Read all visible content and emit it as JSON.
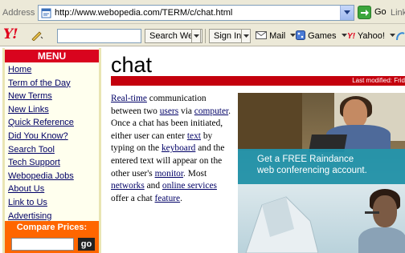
{
  "browser": {
    "address_label": "Address",
    "url": "http://www.webopedia.com/TERM/c/chat.html",
    "go_label": "Go",
    "links_label": "Links"
  },
  "yahoo_toolbar": {
    "logo": "Y!",
    "search_value": "",
    "search_web_label": "Search Web",
    "sign_in_label": "Sign In",
    "mail_label": "Mail",
    "games_label": "Games",
    "yahoo_label": "Yahoo!",
    "yahoo_icon_text": "Y!"
  },
  "menu": {
    "header": "MENU",
    "items": [
      {
        "label": "Home"
      },
      {
        "label": "Term of the Day"
      },
      {
        "label": "New Terms"
      },
      {
        "label": "New Links"
      },
      {
        "label": "Quick Reference"
      },
      {
        "label": "Did You Know?"
      },
      {
        "label": "Search Tool"
      },
      {
        "label": "Tech Support"
      },
      {
        "label": "Webopedia Jobs"
      },
      {
        "label": "About Us"
      },
      {
        "label": "Link to Us"
      },
      {
        "label": "Advertising"
      }
    ],
    "compare_label": "Compare Prices:",
    "compare_value": "",
    "compare_go": "go"
  },
  "article": {
    "title": "chat",
    "last_modified": "Last modified: Frid",
    "body": {
      "w1": "Real-time",
      "t1": " communication between two ",
      "w2": "users",
      "t2": " via ",
      "w3": "computer",
      "t3": ". Once a chat has been initiated, either user can enter ",
      "w4": "text",
      "t4": " by typing on the ",
      "w5": "keyboard",
      "t5": " and the entered text will appear on the other user's ",
      "w6": "monitor",
      "t6": ". Most ",
      "w7": "networks",
      "t7": " and ",
      "w8": "online services",
      "t8": " offer a chat ",
      "w9": "feature",
      "t9": "."
    }
  },
  "ad": {
    "line1": "Get a FREE Raindance",
    "line2": "web conferencing account."
  },
  "colors": {
    "menu_header": "#d9041e",
    "red_bar": "#c4000d",
    "compare_bar": "#ff6600",
    "link": "#000066",
    "ad_band": "#2096b0"
  }
}
